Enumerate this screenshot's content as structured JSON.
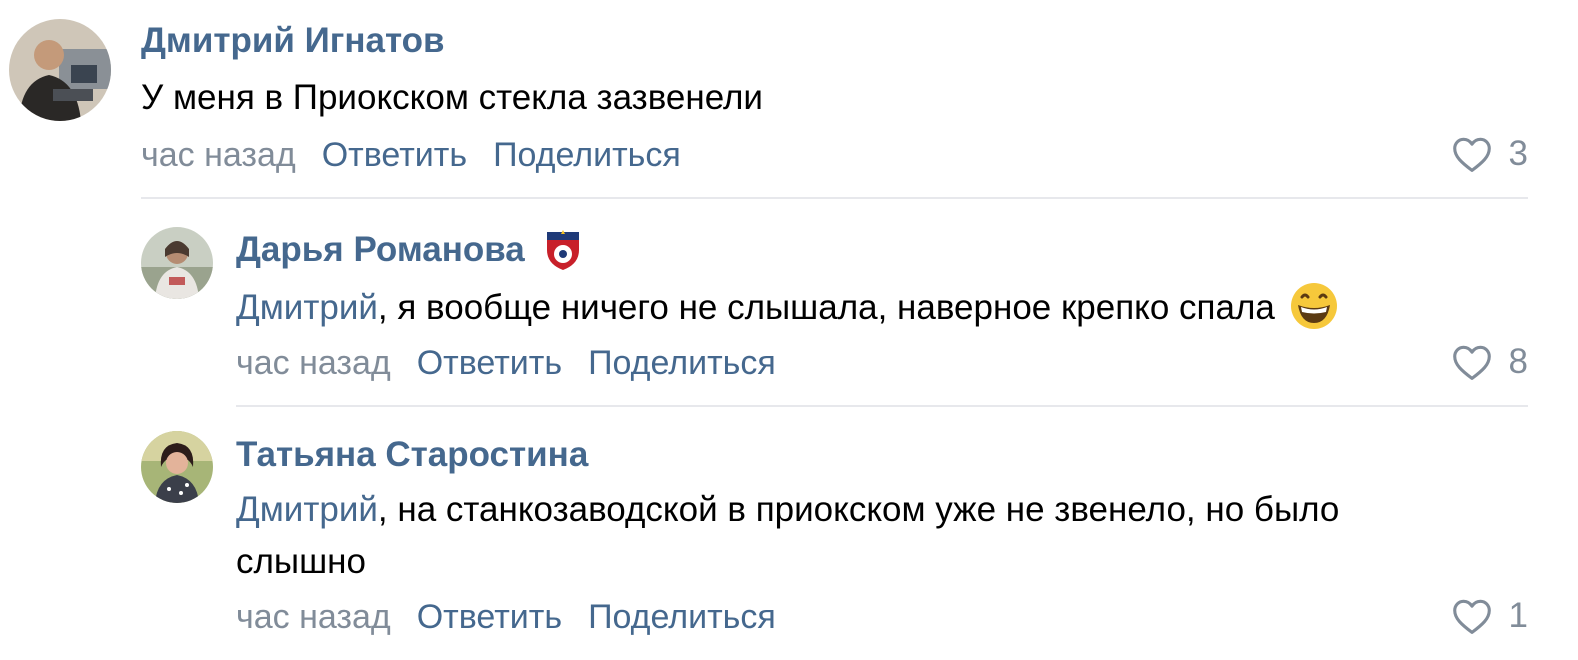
{
  "comments": [
    {
      "author": "Дмитрий Игнатов",
      "text": "У меня в Приокском стекла зазвенели",
      "time": "час назад",
      "reply_label": "Ответить",
      "share_label": "Поделиться",
      "likes": "3"
    },
    {
      "author": "Дарья Романова",
      "mention": "Дмитрий",
      "text": ", я вообще ничего не слышала, наверное крепко спала",
      "time": "час назад",
      "reply_label": "Ответить",
      "share_label": "Поделиться",
      "likes": "8",
      "badge_icon": "cska-club-icon",
      "emoji_icon": "grinning-face-icon"
    },
    {
      "author": "Татьяна Старостина",
      "mention": "Дмитрий",
      "text": ", на станкозаводской в приокском уже не звенело, но было слышно",
      "time": "час назад",
      "reply_label": "Ответить",
      "share_label": "Поделиться",
      "likes": "1"
    }
  ],
  "colors": {
    "link": "#45688e",
    "secondary": "#818c99",
    "divider": "#e7e8ec"
  }
}
